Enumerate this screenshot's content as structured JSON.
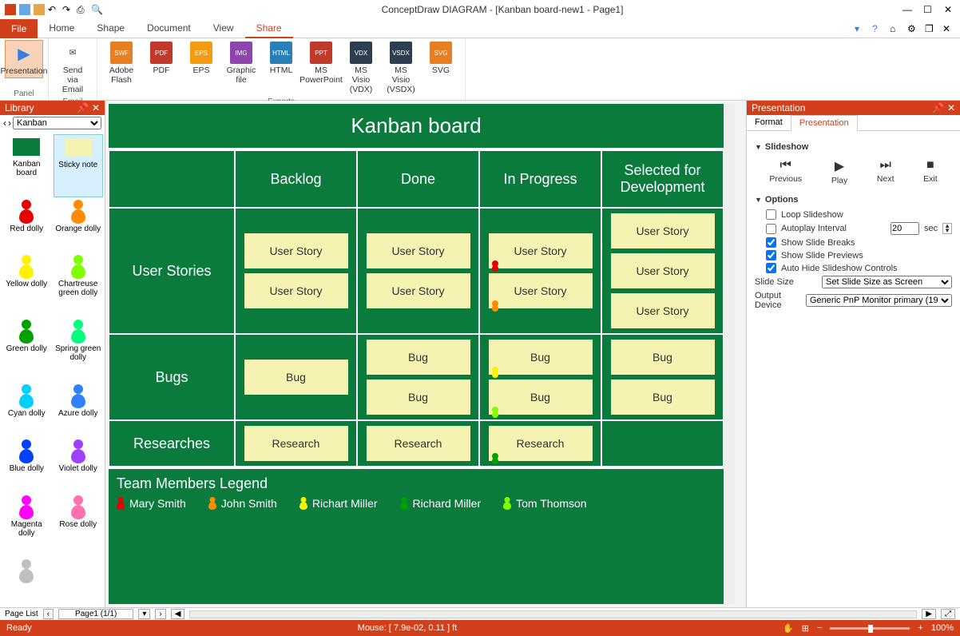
{
  "app": {
    "title": "ConceptDraw DIAGRAM - [Kanban board-new1 - Page1]"
  },
  "menu": {
    "file": "File",
    "tabs": [
      "Home",
      "Shape",
      "Document",
      "View",
      "Share"
    ],
    "active": "Share"
  },
  "ribbon": {
    "panel": {
      "label": "Panel",
      "presentation": "Presentation"
    },
    "email": {
      "label": "Email",
      "sendvia": "Send via Email"
    },
    "exports": {
      "label": "Exports",
      "items": [
        "Adobe Flash",
        "PDF",
        "EPS",
        "Graphic file",
        "HTML",
        "MS PowerPoint",
        "MS Visio (VDX)",
        "MS Visio (VSDX)",
        "SVG"
      ]
    }
  },
  "library": {
    "title": "Library",
    "selected": "Kanban",
    "items": [
      {
        "label": "Kanban board",
        "type": "rect",
        "color": "#0a7a3d"
      },
      {
        "label": "Sticky note",
        "type": "rect",
        "color": "#f4f3b2"
      },
      {
        "label": "Red dolly",
        "type": "dolly",
        "color": "#e60000"
      },
      {
        "label": "Orange dolly",
        "type": "dolly",
        "color": "#ff8c00"
      },
      {
        "label": "Yellow dolly",
        "type": "dolly",
        "color": "#fff200"
      },
      {
        "label": "Chartreuse green dolly",
        "type": "dolly",
        "color": "#7fff00"
      },
      {
        "label": "Green dolly",
        "type": "dolly",
        "color": "#00a000"
      },
      {
        "label": "Spring green dolly",
        "type": "dolly",
        "color": "#00ff7f"
      },
      {
        "label": "Cyan dolly",
        "type": "dolly",
        "color": "#00d0ff"
      },
      {
        "label": "Azure dolly",
        "type": "dolly",
        "color": "#3080ff"
      },
      {
        "label": "Blue dolly",
        "type": "dolly",
        "color": "#0040ff"
      },
      {
        "label": "Violet dolly",
        "type": "dolly",
        "color": "#a040ff"
      },
      {
        "label": "Magenta dolly",
        "type": "dolly",
        "color": "#ff00ff"
      },
      {
        "label": "Rose dolly",
        "type": "dolly",
        "color": "#ff70b0"
      },
      {
        "label": "",
        "type": "dolly",
        "color": "#c0c0c0"
      }
    ]
  },
  "kanban": {
    "title": "Kanban board",
    "columns": [
      "Backlog",
      "Done",
      "In Progress",
      "Selected for Development"
    ],
    "rows": [
      {
        "label": "User Stories",
        "cells": [
          [
            {
              "t": "User Story"
            },
            {
              "t": "User Story"
            }
          ],
          [
            {
              "t": "User Story"
            },
            {
              "t": "User Story"
            }
          ],
          [
            {
              "t": "User Story",
              "pin": "#e60000"
            },
            {
              "t": "User Story",
              "pin": "#ff8c00"
            }
          ],
          [
            {
              "t": "User Story"
            },
            {
              "t": "User Story"
            },
            {
              "t": "User Story"
            }
          ]
        ]
      },
      {
        "label": "Bugs",
        "cells": [
          [
            {
              "t": "Bug"
            }
          ],
          [
            {
              "t": "Bug"
            },
            {
              "t": "Bug"
            }
          ],
          [
            {
              "t": "Bug",
              "pin": "#fff200"
            },
            {
              "t": "Bug",
              "pin": "#7fff00"
            }
          ],
          [
            {
              "t": "Bug"
            },
            {
              "t": "Bug"
            }
          ]
        ]
      },
      {
        "label": "Researches",
        "cells": [
          [
            {
              "t": "Research"
            }
          ],
          [
            {
              "t": "Research"
            }
          ],
          [
            {
              "t": "Research",
              "pin": "#00a000"
            }
          ],
          []
        ]
      }
    ],
    "legend": {
      "title": "Team Members Legend",
      "members": [
        {
          "name": "Mary Smith",
          "color": "#e60000"
        },
        {
          "name": "John Smith",
          "color": "#ff8c00"
        },
        {
          "name": "Richart Miller",
          "color": "#fff200"
        },
        {
          "name": "Richard Miller",
          "color": "#00a000"
        },
        {
          "name": "Tom Thomson",
          "color": "#7fff00"
        }
      ]
    }
  },
  "presentation": {
    "title": "Presentation",
    "tabs": [
      "Format",
      "Presentation"
    ],
    "slideshow": {
      "heading": "Slideshow",
      "previous": "Previous",
      "play": "Play",
      "next": "Next",
      "exit": "Exit"
    },
    "options": {
      "heading": "Options",
      "loop": "Loop Slideshow",
      "autoplay": "Autoplay Interval",
      "autoplay_val": "20",
      "autoplay_unit": "sec",
      "breaks": "Show Slide Breaks",
      "previews": "Show Slide Previews",
      "autohide": "Auto Hide Slideshow Controls",
      "slide_size_label": "Slide Size",
      "slide_size_val": "Set Slide Size as Screen",
      "output_label": "Output Device",
      "output_val": "Generic PnP Monitor primary (19"
    }
  },
  "pagebar": {
    "label": "Page List",
    "current": "Page1 (1/1)"
  },
  "status": {
    "ready": "Ready",
    "mouse": "Mouse: [ 7.9e-02, 0.11 ] ft",
    "zoom": "100%"
  }
}
